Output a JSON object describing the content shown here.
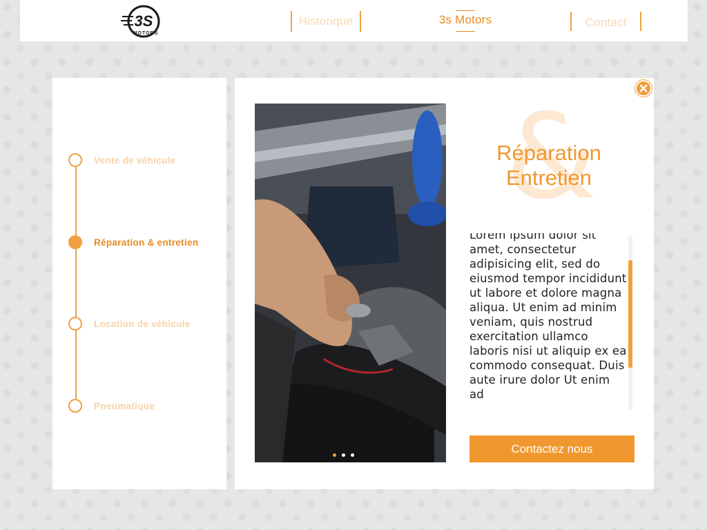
{
  "header": {
    "logo_text": "3S MOTORS",
    "nav": [
      {
        "label": "Historique"
      },
      {
        "label": "3s Motors"
      },
      {
        "label": "Contact"
      }
    ]
  },
  "services": {
    "items": [
      {
        "label": "Vente de véhicule",
        "active": false
      },
      {
        "label": "Réparation & entretien",
        "active": true
      },
      {
        "label": "Location de véhicule",
        "active": false
      },
      {
        "label": "Pneumatique",
        "active": false
      }
    ]
  },
  "detail": {
    "ampersand": "&",
    "title_line1": "Réparation",
    "title_line2": "Entretien",
    "description": "Lorem ipsum dolor sit amet, consectetur adipisicing elit, sed do eiusmod tempor incididunt ut labore et dolore magna aliqua. Ut enim ad minim veniam, quis nostrud exercitation ullamco laboris nisi ut aliquip ex ea commodo consequat. Duis aute irure dolor Ut enim ad",
    "cta_label": "Contactez nous",
    "image_icon": "engine-repair-photo",
    "carousel": {
      "slide_count": 3,
      "active_index": 0
    }
  },
  "colors": {
    "accent": "#f0982f",
    "accent_light": "#f7d2a8",
    "background": "#e6e6e6"
  }
}
